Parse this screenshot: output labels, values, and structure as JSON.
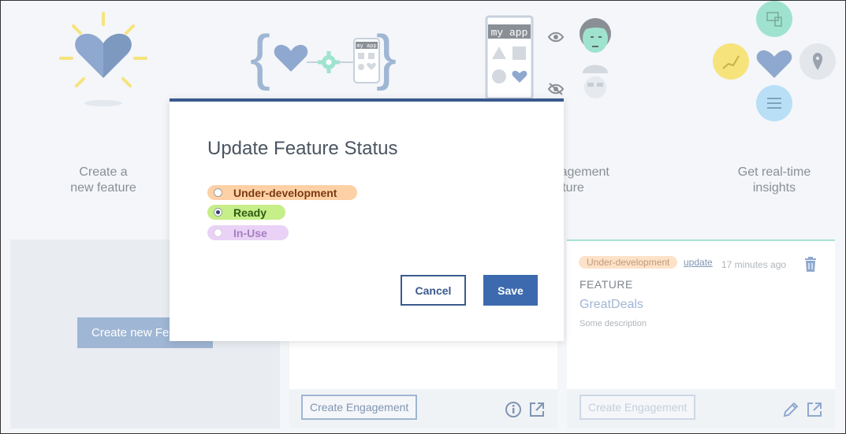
{
  "steps": [
    {
      "label": "Create a\nnew feature"
    },
    {
      "label": "Create an engagement\nfor the feature"
    },
    {
      "label": "Get real-time\ninsights"
    }
  ],
  "illustration": {
    "app_label": "my app",
    "app_label_small": "my app"
  },
  "cards": {
    "left": {
      "create_button": "Create new Feature"
    },
    "middle": {
      "engagement_button": "Create Engagement"
    },
    "right": {
      "status": "Under-development",
      "update_link": "update",
      "timestamp": "17 minutes ago",
      "kicker": "FEATURE",
      "name": "GreatDeals",
      "description": "Some description",
      "engagement_button": "Create Engagement"
    }
  },
  "modal": {
    "title": "Update Feature Status",
    "options": [
      {
        "label": "Under-development",
        "selected": false
      },
      {
        "label": "Ready",
        "selected": true
      },
      {
        "label": "In-Use",
        "selected": false
      }
    ],
    "cancel_label": "Cancel",
    "save_label": "Save"
  },
  "colors": {
    "primary": "#3d6aae",
    "modal_border": "#3a5a8e",
    "dev_pill": "#fdd0a6",
    "ready_pill": "#c6ee89",
    "inuse_pill": "#ead2f6"
  },
  "icons": [
    "heart-icon",
    "gear-icon",
    "eye-icon",
    "eye-slash-icon",
    "trash-icon",
    "info-icon",
    "external-link-icon",
    "pencil-icon",
    "chart-icon",
    "location-pin-icon",
    "sliders-icon",
    "devices-icon"
  ]
}
